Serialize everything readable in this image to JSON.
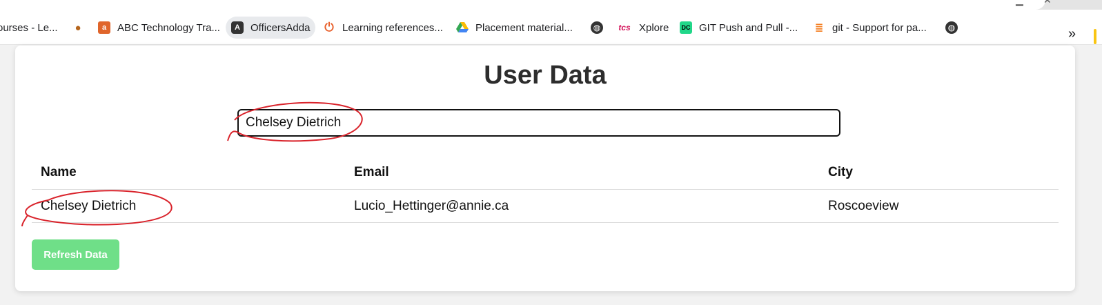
{
  "bookmarks": [
    {
      "label": "ourses - Le...",
      "icon": "partial-site-icon"
    },
    {
      "label": "",
      "icon": "cookie-icon"
    },
    {
      "label": "ABC Technology Tra...",
      "icon": "abc-logo-icon"
    },
    {
      "label": "OfficersAdda",
      "icon": "angular-icon"
    },
    {
      "label": "Learning references...",
      "icon": "power-icon"
    },
    {
      "label": "Placement material...",
      "icon": "drive-icon"
    },
    {
      "label": "",
      "icon": "globe-icon"
    },
    {
      "label": "Xplore",
      "icon": "tcs-icon",
      "icon_text": "tcs"
    },
    {
      "label": "GIT Push and Pull -...",
      "icon": "dc-icon",
      "icon_text": "DC"
    },
    {
      "label": "git - Support for pa...",
      "icon": "stackoverflow-icon"
    },
    {
      "label": "",
      "icon": "globe-icon"
    }
  ],
  "chevron": "»",
  "page": {
    "title": "User Data",
    "search_value": "Chelsey Dietrich"
  },
  "table": {
    "headers": [
      "Name",
      "Email",
      "City"
    ],
    "rows": [
      [
        "Chelsey Dietrich",
        "Lucio_Hettinger@annie.ca",
        "Roscoeview"
      ]
    ]
  },
  "refresh_label": "Refresh Data",
  "colors": {
    "refresh_button": "#6fdf88",
    "annotation": "#d9232b"
  }
}
